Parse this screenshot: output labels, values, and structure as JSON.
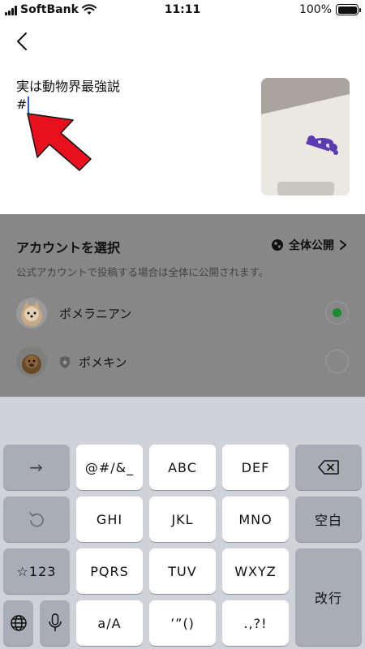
{
  "status_bar": {
    "carrier": "SoftBank",
    "time": "11:11",
    "battery": "100%"
  },
  "editor": {
    "text_line1": "実は動物界最強説",
    "text_line2": "#"
  },
  "sheet": {
    "title": "アカウントを選択",
    "visibility_label": "全体公開",
    "note": "公式アカウントで投稿する場合は全体に公開されます。",
    "accounts": [
      {
        "name": "ポメラニアン",
        "selected": true
      },
      {
        "name": "ポメキン",
        "selected": false
      }
    ]
  },
  "keyboard": {
    "row1": [
      "→",
      "@#/&_",
      "ABC",
      "DEF"
    ],
    "row2": [
      "GHI",
      "JKL",
      "MNO",
      "空白"
    ],
    "row3": [
      "☆123",
      "PQRS",
      "TUV",
      "WXYZ"
    ],
    "row4": [
      "a/A",
      "’”()",
      ".,?!"
    ],
    "return_label": "改行"
  },
  "colors": {
    "caret": "#2b5fd9",
    "arrow": "#e8101c",
    "radio_selected": "#1e8a2e",
    "sheet_overlay": "#878787",
    "keyboard_bg": "#cfd2d8"
  }
}
